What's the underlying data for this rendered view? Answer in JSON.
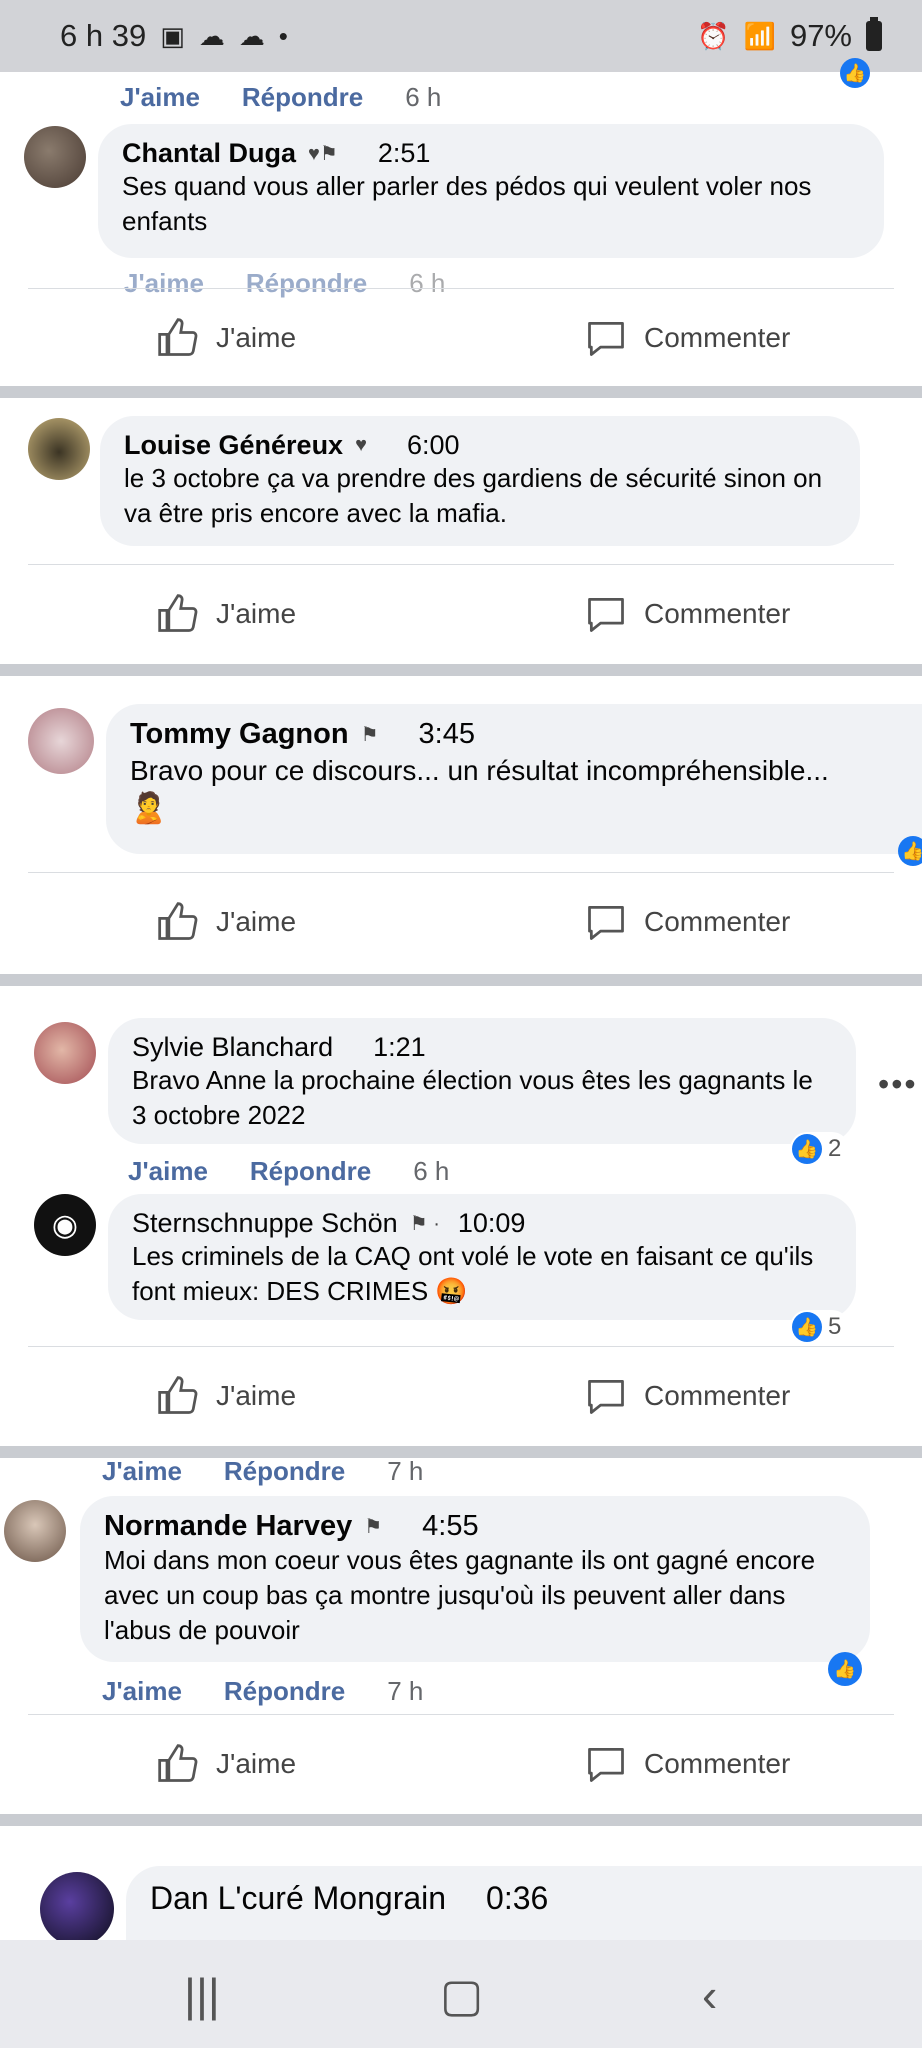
{
  "status": {
    "time": "6 h 39",
    "battery": "97%"
  },
  "labels": {
    "like": "J'aime",
    "reply": "Répondre",
    "comment": "Commenter"
  },
  "comments": [
    {
      "name": "Chantal Duga",
      "time": "2:51",
      "text": "Ses quand vous aller parler des pédos qui veulent voler nos enfants",
      "age_top": "6 h",
      "age_bottom": "6 h"
    },
    {
      "name": "Louise Généreux",
      "time": "6:00",
      "text": "le 3 octobre ça va prendre des gardiens de sécurité sinon on va être pris encore avec la mafia."
    },
    {
      "name": "Tommy Gagnon",
      "time": "3:45",
      "text": "Bravo pour ce discours... un résultat incompréhensible...",
      "emoji": "🙎"
    },
    {
      "name": "Sylvie Blanchard",
      "time": "1:21",
      "text": "Bravo Anne la prochaine élection vous êtes les gagnants le 3 octobre 2022",
      "reactions": "2",
      "age": "6 h"
    },
    {
      "name": "Sternschnuppe Schön",
      "time": "10:09",
      "text": "Les criminels de la CAQ ont volé le vote en faisant ce qu'ils font mieux: DES CRIMES 🤬",
      "reactions": "5"
    },
    {
      "name": "Normande Harvey",
      "time": "4:55",
      "text": "Moi dans mon coeur vous êtes gagnante ils ont gagné encore avec un coup bas ça montre jusqu'où ils peuvent aller dans l'abus de pouvoir",
      "age": "7 h"
    },
    {
      "name": "Dan L'curé Mongrain",
      "time": "0:36"
    }
  ],
  "colors": {
    "link": "#4b6aa0",
    "bubble": "#f0f2f5",
    "separator": "#c9ccd1",
    "like_blue": "#1877f2"
  }
}
